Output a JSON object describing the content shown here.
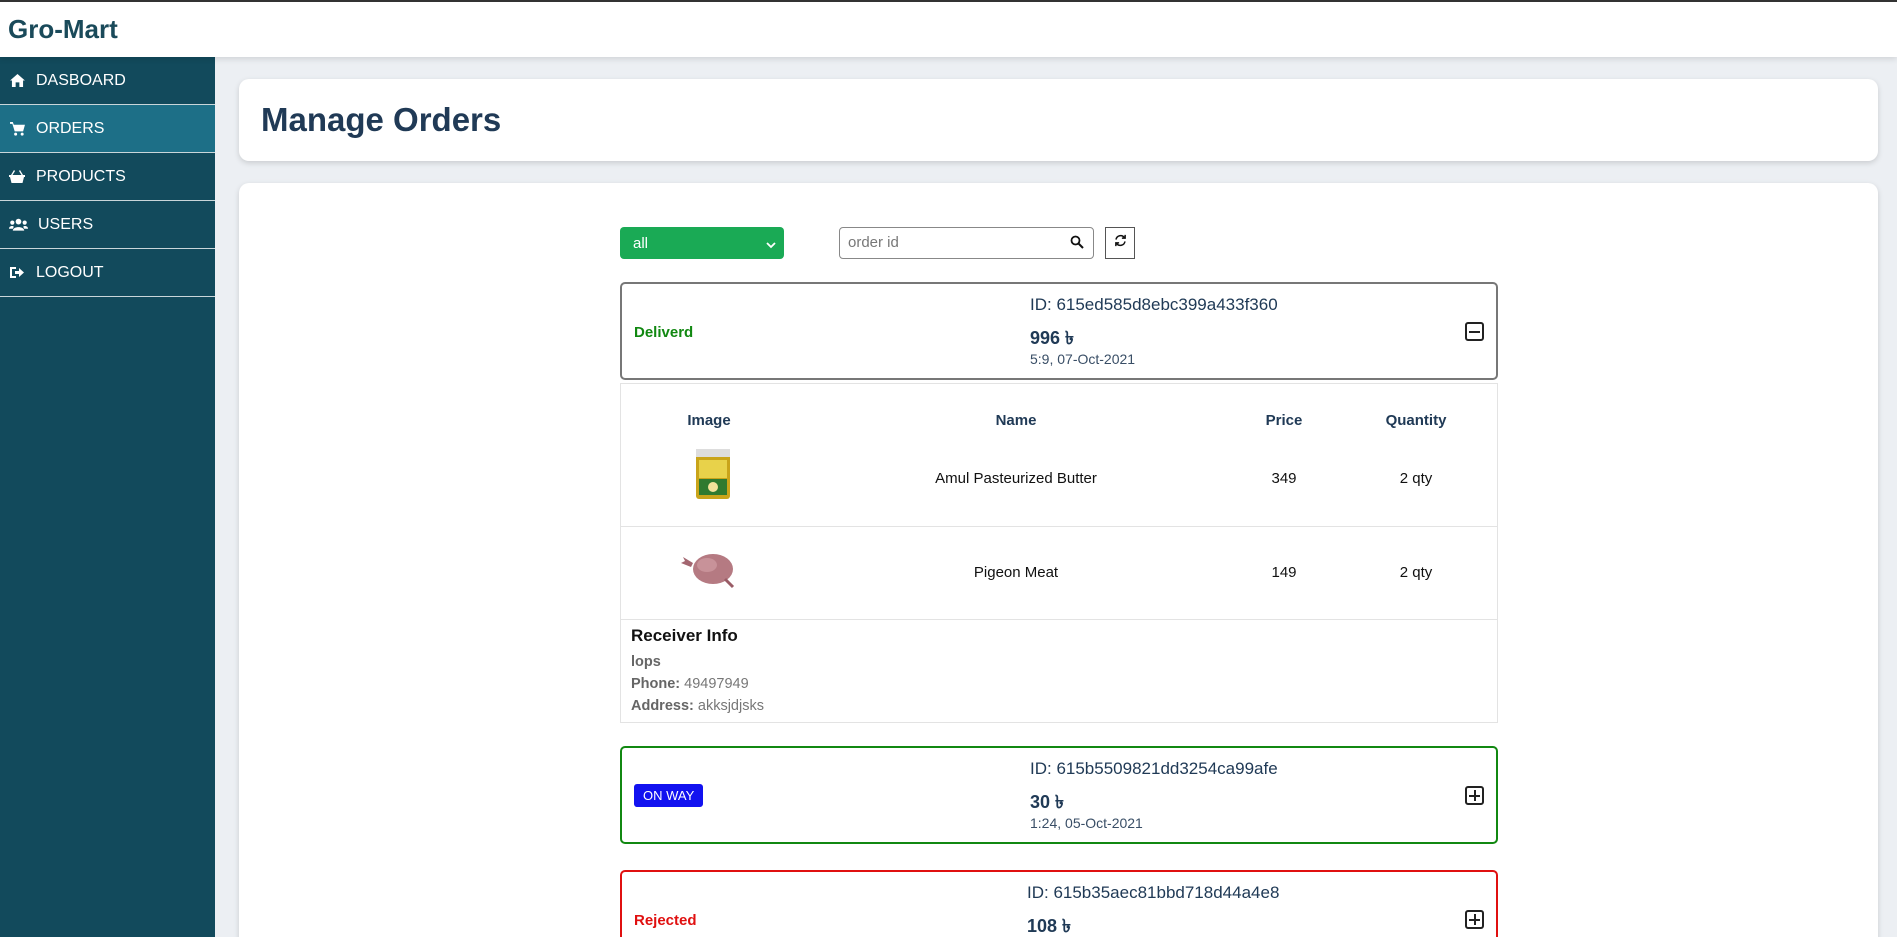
{
  "app": {
    "brand": "Gro-Mart"
  },
  "sidebar": {
    "items": [
      {
        "label": "DASBOARD",
        "icon": "home-icon"
      },
      {
        "label": "ORDERS",
        "icon": "cart-icon",
        "active": true
      },
      {
        "label": "PRODUCTS",
        "icon": "basket-icon"
      },
      {
        "label": "USERS",
        "icon": "users-icon"
      },
      {
        "label": "LOGOUT",
        "icon": "logout-icon"
      }
    ]
  },
  "page": {
    "title": "Manage Orders"
  },
  "filters": {
    "status_value": "all",
    "search_placeholder": "order id",
    "search_value": ""
  },
  "colors": {
    "sidebar_bg": "#124a5c",
    "sidebar_active": "#1d6f87",
    "select_bg": "#1aaa55",
    "delivered": "#118811",
    "on_way_badge": "#1212f0",
    "rejected": "#e01010"
  },
  "table": {
    "headers": [
      "Image",
      "Name",
      "Price",
      "Quantity"
    ]
  },
  "orders": [
    {
      "status": "Deliverd",
      "id_text": "ID: 615ed585d8ebc399a433f360",
      "price": "996 ৳",
      "date": "5:9, 07-Oct-2021",
      "expanded": true,
      "items": [
        {
          "image": "butter-jar-image",
          "name": "Amul Pasteurized Butter",
          "price": "349",
          "qty": "2 qty"
        },
        {
          "image": "pigeon-meat-image",
          "name": "Pigeon Meat",
          "price": "149",
          "qty": "2 qty"
        }
      ],
      "receiver": {
        "title": "Receiver Info",
        "name": "lops",
        "phone_label": "Phone:",
        "phone": "49497949",
        "address_label": "Address:",
        "address": "akksjdjsks"
      }
    },
    {
      "status": "ON WAY",
      "id_text": "ID: 615b5509821dd3254ca99afe",
      "price": "30 ৳",
      "date": "1:24, 05-Oct-2021",
      "expanded": false
    },
    {
      "status": "Rejected",
      "id_text": "ID: 615b35aec81bbd718d44a4e8",
      "price": "108 ৳",
      "date": "",
      "expanded": false
    }
  ]
}
